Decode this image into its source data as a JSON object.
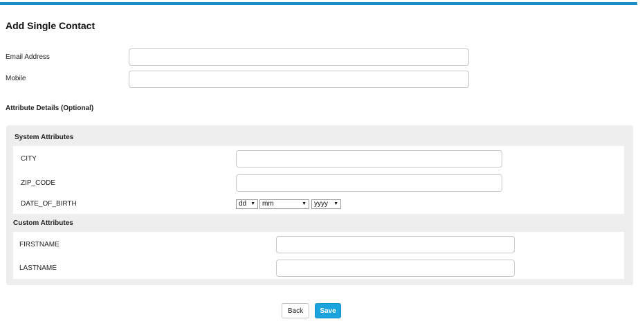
{
  "page": {
    "title": "Add Single Contact"
  },
  "form": {
    "email_label": "Email Address",
    "email_value": "",
    "mobile_label": "Mobile",
    "mobile_value": "",
    "attribute_details_label": "Attribute Details (Optional)"
  },
  "system_attributes": {
    "heading": "System Attributes",
    "city_label": "CITY",
    "zip_label": "ZIP_CODE",
    "dob_label": "DATE_OF_BIRTH",
    "dob_day": "dd",
    "dob_month": "mm",
    "dob_year": "yyyy"
  },
  "custom_attributes": {
    "heading": "Custom Attributes",
    "firstname_label": "FIRSTNAME",
    "lastname_label": "LASTNAME"
  },
  "actions": {
    "back_label": "Back",
    "save_label": "Save"
  },
  "colors": {
    "accent": "#1a8fc4",
    "save_button": "#1ba3dd",
    "panel_bg": "#eeeeee"
  }
}
